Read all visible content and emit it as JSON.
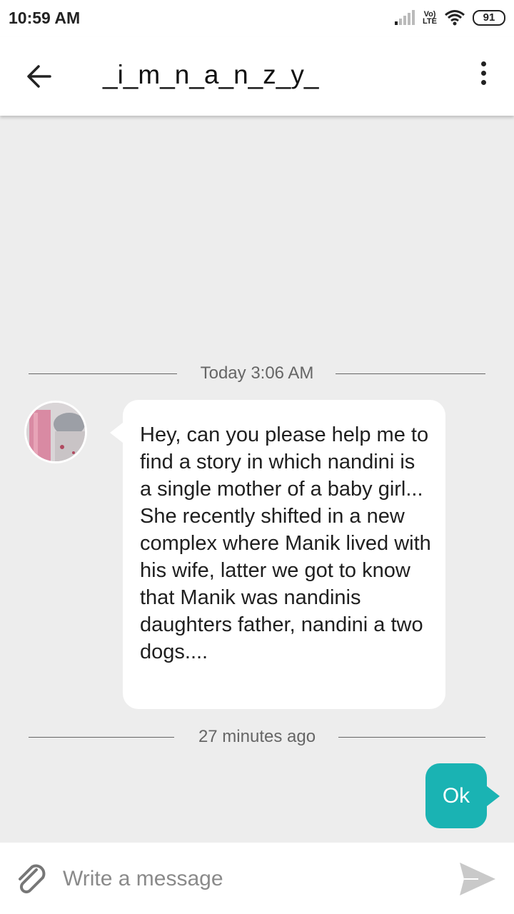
{
  "status_bar": {
    "time": "10:59 AM",
    "volte_top": "Vo)",
    "volte_bottom": "LTE",
    "battery": "91"
  },
  "header": {
    "title": "_i_m_n_a_n_z_y_",
    "back_icon": "arrow-left-icon",
    "menu_icon": "more-vert-icon"
  },
  "conversation": {
    "divider_1": "Today 3:06 AM",
    "incoming_message": "Hey, can you please help me to find a story in which nandini is a single mother of a baby girl... She recently shifted in a new complex where Manik lived with his wife, latter we got to know that Manik was nandinis daughters father, nandini a two dogs....",
    "divider_2": "27 minutes ago",
    "outgoing_message": "Ok"
  },
  "composer": {
    "placeholder": "Write a message",
    "attach_icon": "paperclip-icon",
    "send_icon": "send-icon"
  },
  "colors": {
    "accent": "#1ab3b3",
    "background": "#ededed"
  }
}
